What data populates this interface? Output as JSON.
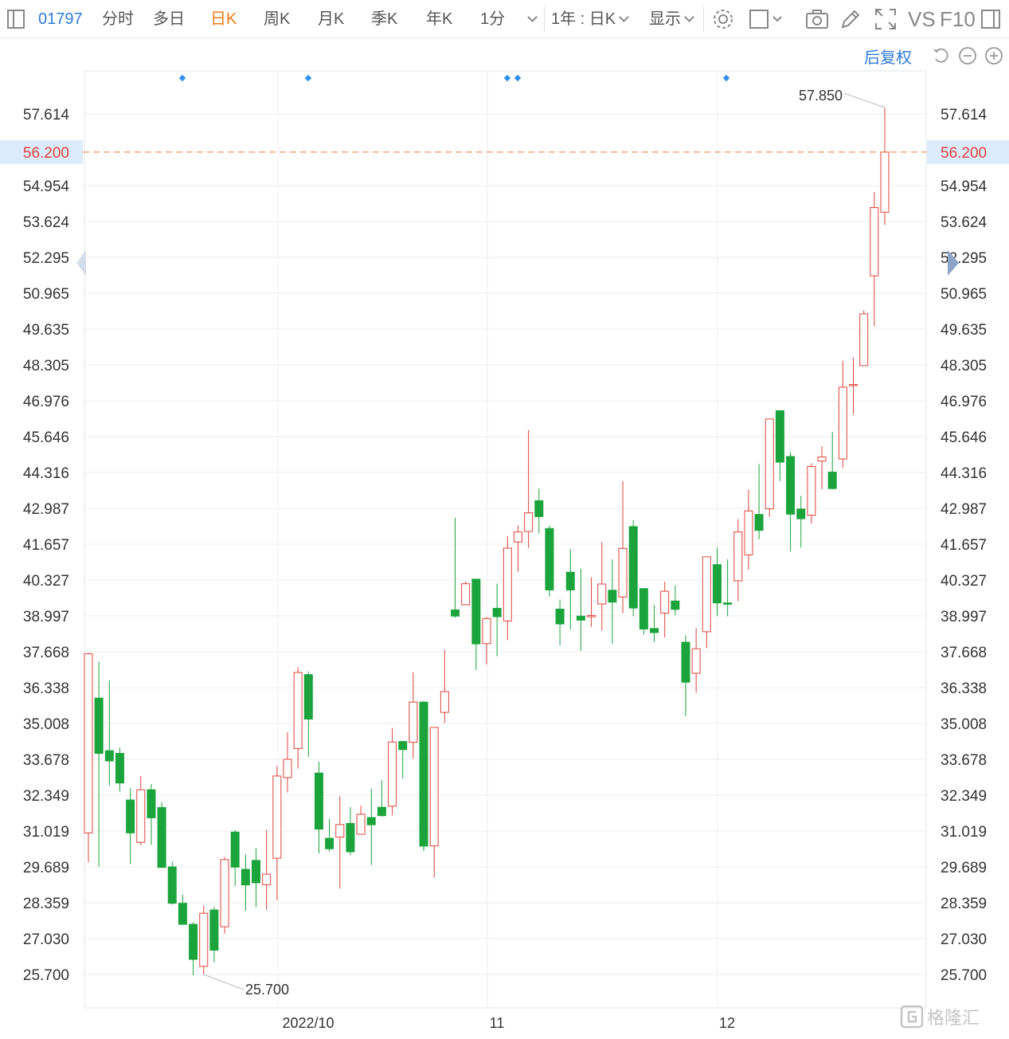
{
  "toolbar": {
    "code": "01797",
    "tabs": [
      "分时",
      "多日",
      "日K",
      "周K",
      "月K",
      "季K",
      "年K",
      "1分"
    ],
    "active_tab": "日K",
    "range_select": "1年 : 日K",
    "display_select": "显示",
    "vs_label": "VS",
    "f10_label": "F10"
  },
  "adjust_label": "后复权",
  "watermark_text": "格隆汇",
  "colors": {
    "up": "#e0443a",
    "down": "#1aa43b",
    "current_line": "#f07a3a",
    "current_label": "#e0443a",
    "grid": "#eeeeee",
    "marker": "#2f8ff0"
  },
  "chart_data": {
    "type": "candlestick",
    "y_ticks": [
      "57.614",
      "54.954",
      "53.624",
      "52.295",
      "50.965",
      "49.635",
      "48.305",
      "46.976",
      "45.646",
      "44.316",
      "42.987",
      "41.657",
      "40.327",
      "38.997",
      "37.668",
      "36.338",
      "35.008",
      "33.678",
      "32.349",
      "31.019",
      "29.689",
      "28.359",
      "27.030",
      "25.700"
    ],
    "y_range": [
      24.0,
      59.19
    ],
    "x_labels": [
      "2022/10",
      "11",
      "12"
    ],
    "current_price": "56.200",
    "max_label": "57.850",
    "min_label": "25.700",
    "event_markers": 5,
    "candles": [
      {
        "o": 30.95,
        "h": 37.63,
        "l": 29.86,
        "c": 37.59
      },
      {
        "o": 35.95,
        "h": 37.3,
        "l": 29.7,
        "c": 33.9
      },
      {
        "o": 34.0,
        "h": 36.6,
        "l": 32.7,
        "c": 33.62
      },
      {
        "o": 33.9,
        "h": 34.12,
        "l": 32.49,
        "c": 32.8
      },
      {
        "o": 32.17,
        "h": 32.61,
        "l": 29.79,
        "c": 30.95
      },
      {
        "o": 30.6,
        "h": 33.06,
        "l": 30.49,
        "c": 32.55
      },
      {
        "o": 32.55,
        "h": 32.76,
        "l": 30.51,
        "c": 31.51
      },
      {
        "o": 31.89,
        "h": 32.09,
        "l": 29.69,
        "c": 29.67
      },
      {
        "o": 29.69,
        "h": 29.88,
        "l": 28.29,
        "c": 28.34
      },
      {
        "o": 28.34,
        "h": 28.66,
        "l": 27.59,
        "c": 27.56
      },
      {
        "o": 27.56,
        "h": 27.64,
        "l": 25.67,
        "c": 26.26
      },
      {
        "o": 26.0,
        "h": 28.27,
        "l": 25.7,
        "c": 27.97
      },
      {
        "o": 28.09,
        "h": 28.2,
        "l": 26.15,
        "c": 26.6
      },
      {
        "o": 27.47,
        "h": 30.06,
        "l": 27.21,
        "c": 29.96
      },
      {
        "o": 30.98,
        "h": 31.06,
        "l": 28.98,
        "c": 29.68
      },
      {
        "o": 29.6,
        "h": 30.15,
        "l": 28.06,
        "c": 29.02
      },
      {
        "o": 29.93,
        "h": 30.38,
        "l": 28.2,
        "c": 29.1
      },
      {
        "o": 29.03,
        "h": 31.06,
        "l": 28.1,
        "c": 29.42
      },
      {
        "o": 30.01,
        "h": 33.44,
        "l": 28.45,
        "c": 33.06
      },
      {
        "o": 33.0,
        "h": 34.68,
        "l": 32.45,
        "c": 33.68
      },
      {
        "o": 34.08,
        "h": 37.09,
        "l": 33.33,
        "c": 36.9
      },
      {
        "o": 36.82,
        "h": 36.94,
        "l": 33.78,
        "c": 35.17
      },
      {
        "o": 33.17,
        "h": 33.59,
        "l": 30.19,
        "c": 31.09
      },
      {
        "o": 30.75,
        "h": 31.47,
        "l": 30.25,
        "c": 30.36
      },
      {
        "o": 30.79,
        "h": 32.31,
        "l": 28.88,
        "c": 31.26
      },
      {
        "o": 31.3,
        "h": 31.91,
        "l": 30.13,
        "c": 30.25
      },
      {
        "o": 30.9,
        "h": 31.96,
        "l": 30.89,
        "c": 31.64
      },
      {
        "o": 31.52,
        "h": 32.59,
        "l": 29.76,
        "c": 31.25
      },
      {
        "o": 31.9,
        "h": 32.9,
        "l": 31.55,
        "c": 31.59
      },
      {
        "o": 31.94,
        "h": 34.84,
        "l": 31.6,
        "c": 34.32
      },
      {
        "o": 34.34,
        "h": 34.32,
        "l": 32.97,
        "c": 34.04
      },
      {
        "o": 34.31,
        "h": 36.91,
        "l": 33.71,
        "c": 35.8
      },
      {
        "o": 35.8,
        "h": 35.84,
        "l": 30.28,
        "c": 30.46
      },
      {
        "o": 30.47,
        "h": 34.35,
        "l": 29.29,
        "c": 34.86
      },
      {
        "o": 35.42,
        "h": 37.74,
        "l": 35.02,
        "c": 36.19
      },
      {
        "o": 39.22,
        "h": 42.64,
        "l": 38.93,
        "c": 38.99
      },
      {
        "o": 39.41,
        "h": 40.28,
        "l": 39.65,
        "c": 40.19
      },
      {
        "o": 40.36,
        "h": 40.34,
        "l": 36.99,
        "c": 37.96
      },
      {
        "o": 37.97,
        "h": 38.95,
        "l": 37.2,
        "c": 38.9
      },
      {
        "o": 39.28,
        "h": 40.2,
        "l": 37.5,
        "c": 38.97
      },
      {
        "o": 38.81,
        "h": 41.96,
        "l": 38.1,
        "c": 41.51
      },
      {
        "o": 41.74,
        "h": 42.35,
        "l": 40.64,
        "c": 42.11
      },
      {
        "o": 42.13,
        "h": 45.89,
        "l": 41.52,
        "c": 42.82
      },
      {
        "o": 43.27,
        "h": 43.72,
        "l": 42.06,
        "c": 42.68
      },
      {
        "o": 42.24,
        "h": 42.35,
        "l": 39.71,
        "c": 39.96
      },
      {
        "o": 39.25,
        "h": 39.6,
        "l": 37.9,
        "c": 38.7
      },
      {
        "o": 40.62,
        "h": 41.48,
        "l": 38.48,
        "c": 39.96
      },
      {
        "o": 38.99,
        "h": 40.75,
        "l": 37.7,
        "c": 38.84
      },
      {
        "o": 38.99,
        "h": 40.43,
        "l": 38.59,
        "c": 39.01
      },
      {
        "o": 39.44,
        "h": 41.74,
        "l": 38.46,
        "c": 40.18
      },
      {
        "o": 39.95,
        "h": 41.09,
        "l": 37.96,
        "c": 39.51
      },
      {
        "o": 39.7,
        "h": 44.0,
        "l": 39.1,
        "c": 41.5
      },
      {
        "o": 42.31,
        "h": 42.55,
        "l": 38.99,
        "c": 39.29
      },
      {
        "o": 40.01,
        "h": 40.03,
        "l": 38.3,
        "c": 38.51
      },
      {
        "o": 38.53,
        "h": 39.41,
        "l": 38.03,
        "c": 38.38
      },
      {
        "o": 39.1,
        "h": 40.26,
        "l": 38.2,
        "c": 39.91
      },
      {
        "o": 39.55,
        "h": 40.13,
        "l": 39.02,
        "c": 39.24
      },
      {
        "o": 38.02,
        "h": 38.28,
        "l": 35.28,
        "c": 36.54
      },
      {
        "o": 36.87,
        "h": 38.55,
        "l": 36.15,
        "c": 37.78
      },
      {
        "o": 38.41,
        "h": 41.04,
        "l": 37.79,
        "c": 41.19
      },
      {
        "o": 40.9,
        "h": 41.53,
        "l": 39.0,
        "c": 39.48
      },
      {
        "o": 39.48,
        "h": 41.1,
        "l": 38.98,
        "c": 39.43
      },
      {
        "o": 40.3,
        "h": 42.59,
        "l": 39.54,
        "c": 42.11
      },
      {
        "o": 41.26,
        "h": 43.68,
        "l": 40.71,
        "c": 42.89
      },
      {
        "o": 42.76,
        "h": 44.63,
        "l": 41.84,
        "c": 42.17
      },
      {
        "o": 42.97,
        "h": 45.79,
        "l": 42.67,
        "c": 46.3
      },
      {
        "o": 46.61,
        "h": 46.61,
        "l": 44.0,
        "c": 44.7
      },
      {
        "o": 44.91,
        "h": 45.08,
        "l": 41.39,
        "c": 42.77
      },
      {
        "o": 42.96,
        "h": 43.46,
        "l": 41.53,
        "c": 42.6
      },
      {
        "o": 42.73,
        "h": 44.66,
        "l": 42.42,
        "c": 44.54
      },
      {
        "o": 44.74,
        "h": 45.29,
        "l": 43.69,
        "c": 44.89
      },
      {
        "o": 44.33,
        "h": 45.82,
        "l": 43.69,
        "c": 43.72
      },
      {
        "o": 44.82,
        "h": 48.45,
        "l": 44.49,
        "c": 47.48
      },
      {
        "o": 47.54,
        "h": 48.58,
        "l": 46.46,
        "c": 47.58
      },
      {
        "o": 48.28,
        "h": 50.33,
        "l": 48.3,
        "c": 50.2
      },
      {
        "o": 51.61,
        "h": 54.72,
        "l": 49.74,
        "c": 54.14
      },
      {
        "o": 53.97,
        "h": 57.85,
        "l": 53.5,
        "c": 56.2
      }
    ]
  }
}
